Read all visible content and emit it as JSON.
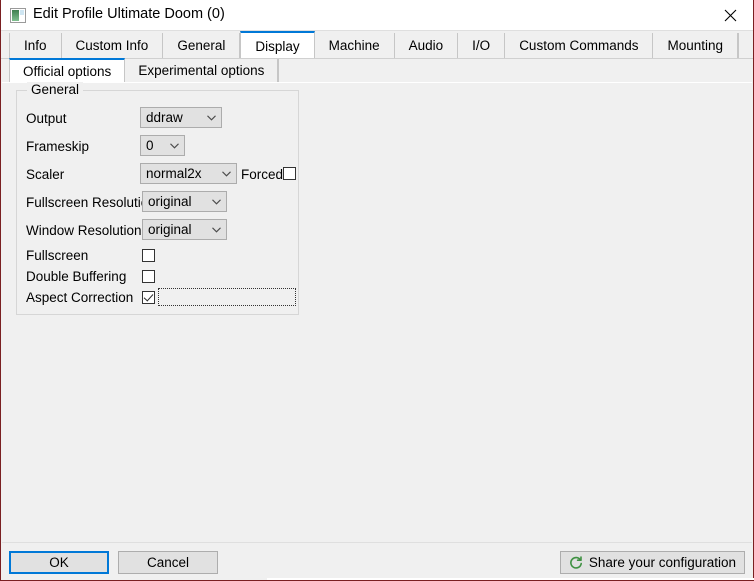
{
  "window": {
    "title": "Edit Profile Ultimate Doom (0)",
    "app_icon": "profile-window-icon",
    "close_icon": "close-icon",
    "accent_color": "#0078d7",
    "border_color": "#7a1f21",
    "face_color": "#f0f0f0"
  },
  "tabs": [
    {
      "label": "Info",
      "selected": false
    },
    {
      "label": "Custom Info",
      "selected": false
    },
    {
      "label": "General",
      "selected": false
    },
    {
      "label": "Display",
      "selected": true
    },
    {
      "label": "Machine",
      "selected": false
    },
    {
      "label": "Audio",
      "selected": false
    },
    {
      "label": "I/O",
      "selected": false
    },
    {
      "label": "Custom Commands",
      "selected": false
    },
    {
      "label": "Mounting",
      "selected": false
    }
  ],
  "subtabs": [
    {
      "label": "Official options",
      "selected": true
    },
    {
      "label": "Experimental options",
      "selected": false
    }
  ],
  "general_group": {
    "legend": "General",
    "fields": {
      "output": {
        "label": "Output",
        "value": "ddraw"
      },
      "frameskip": {
        "label": "Frameskip",
        "value": "0"
      },
      "scaler": {
        "label": "Scaler",
        "value": "normal2x"
      },
      "forced": {
        "label": "Forced",
        "checked": false
      },
      "fullscreen_resolution": {
        "label": "Fullscreen Resolution",
        "value": "original"
      },
      "window_resolution": {
        "label": "Window Resolution",
        "value": "original"
      },
      "fullscreen": {
        "label": "Fullscreen",
        "checked": false
      },
      "double_buffering": {
        "label": "Double Buffering",
        "checked": false
      },
      "aspect_correction": {
        "label": "Aspect Correction",
        "checked": true,
        "focused": true
      }
    }
  },
  "bottom_bar": {
    "ok_label": "OK",
    "cancel_label": "Cancel",
    "share_label": "Share your configuration",
    "share_icon": "refresh-circle-icon",
    "share_icon_color": "#3f9142"
  }
}
